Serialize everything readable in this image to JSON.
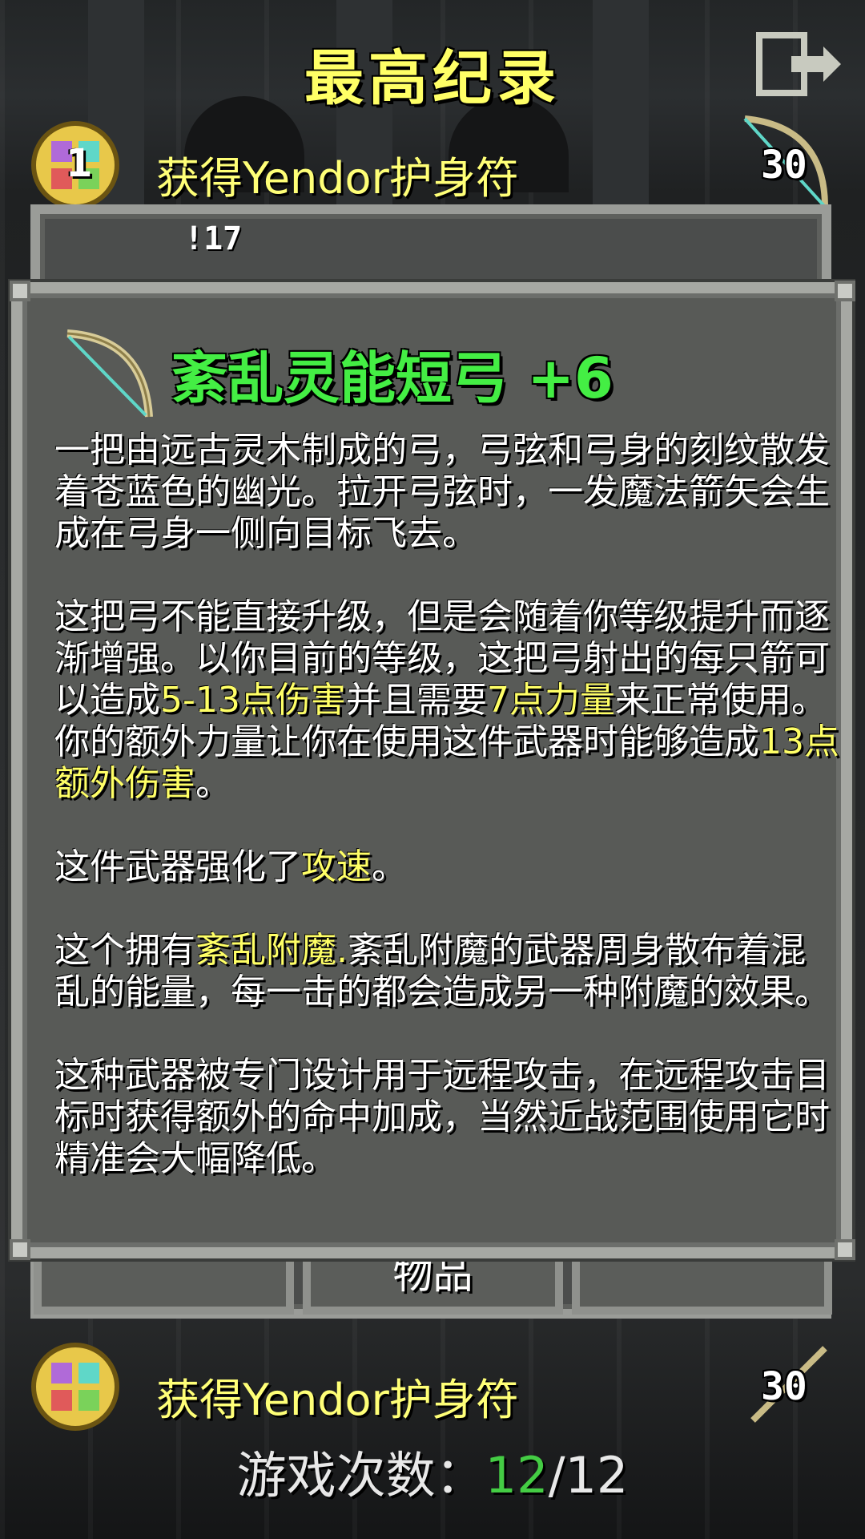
{
  "header": {
    "title": "最高纪录"
  },
  "records": [
    {
      "rank": "1",
      "text": "获得Yendor护身符",
      "depth": "30"
    },
    {
      "rank": "",
      "text": "获得Yendor护身符",
      "depth": "30"
    }
  ],
  "back_window": {
    "snippet": "!17",
    "tabs": [
      "",
      "物品",
      ""
    ]
  },
  "item": {
    "name": "紊乱灵能短弓 +6",
    "paragraphs": [
      [
        "一把由远古灵木制成的弓，弓弦和弓身的刻纹散发着苍蓝色的幽光。拉开弓弦时，一发魔法箭矢会生成在弓身一侧向目标飞去。"
      ],
      [
        "这把弓不能直接升级，但是会随着你等级提升而逐渐增强。以你目前的等级，这把弓射出的每只箭可以造成",
        "5-13点伤害",
        "并且需要",
        "7点力量",
        "来正常使用。你的额外力量让你在使用这件武器时能够造成",
        "13点额外伤害",
        "。"
      ],
      [
        "这件武器强化了",
        "攻速",
        "。"
      ],
      [
        "这个拥有",
        "紊乱附魔.",
        "紊乱附魔的武器周身散布着混乱的能量，每一击的都会造成另一种附魔的效果。"
      ],
      [
        "这种武器被专门设计用于远程攻击，在远程攻击目标时获得额外的命中加成，当然近战范围使用它时精准会大幅降低。"
      ]
    ]
  },
  "stats": {
    "label": "游戏次数：",
    "won": "12",
    "separator": "/",
    "total": "12"
  },
  "colors": {
    "title": "#ffff66",
    "item_name": "#44ee44",
    "highlight": "#ffff66",
    "won": "#44cc44"
  },
  "icons": [
    "exit-icon",
    "amulet-medal-icon",
    "spirit-bow-icon"
  ]
}
